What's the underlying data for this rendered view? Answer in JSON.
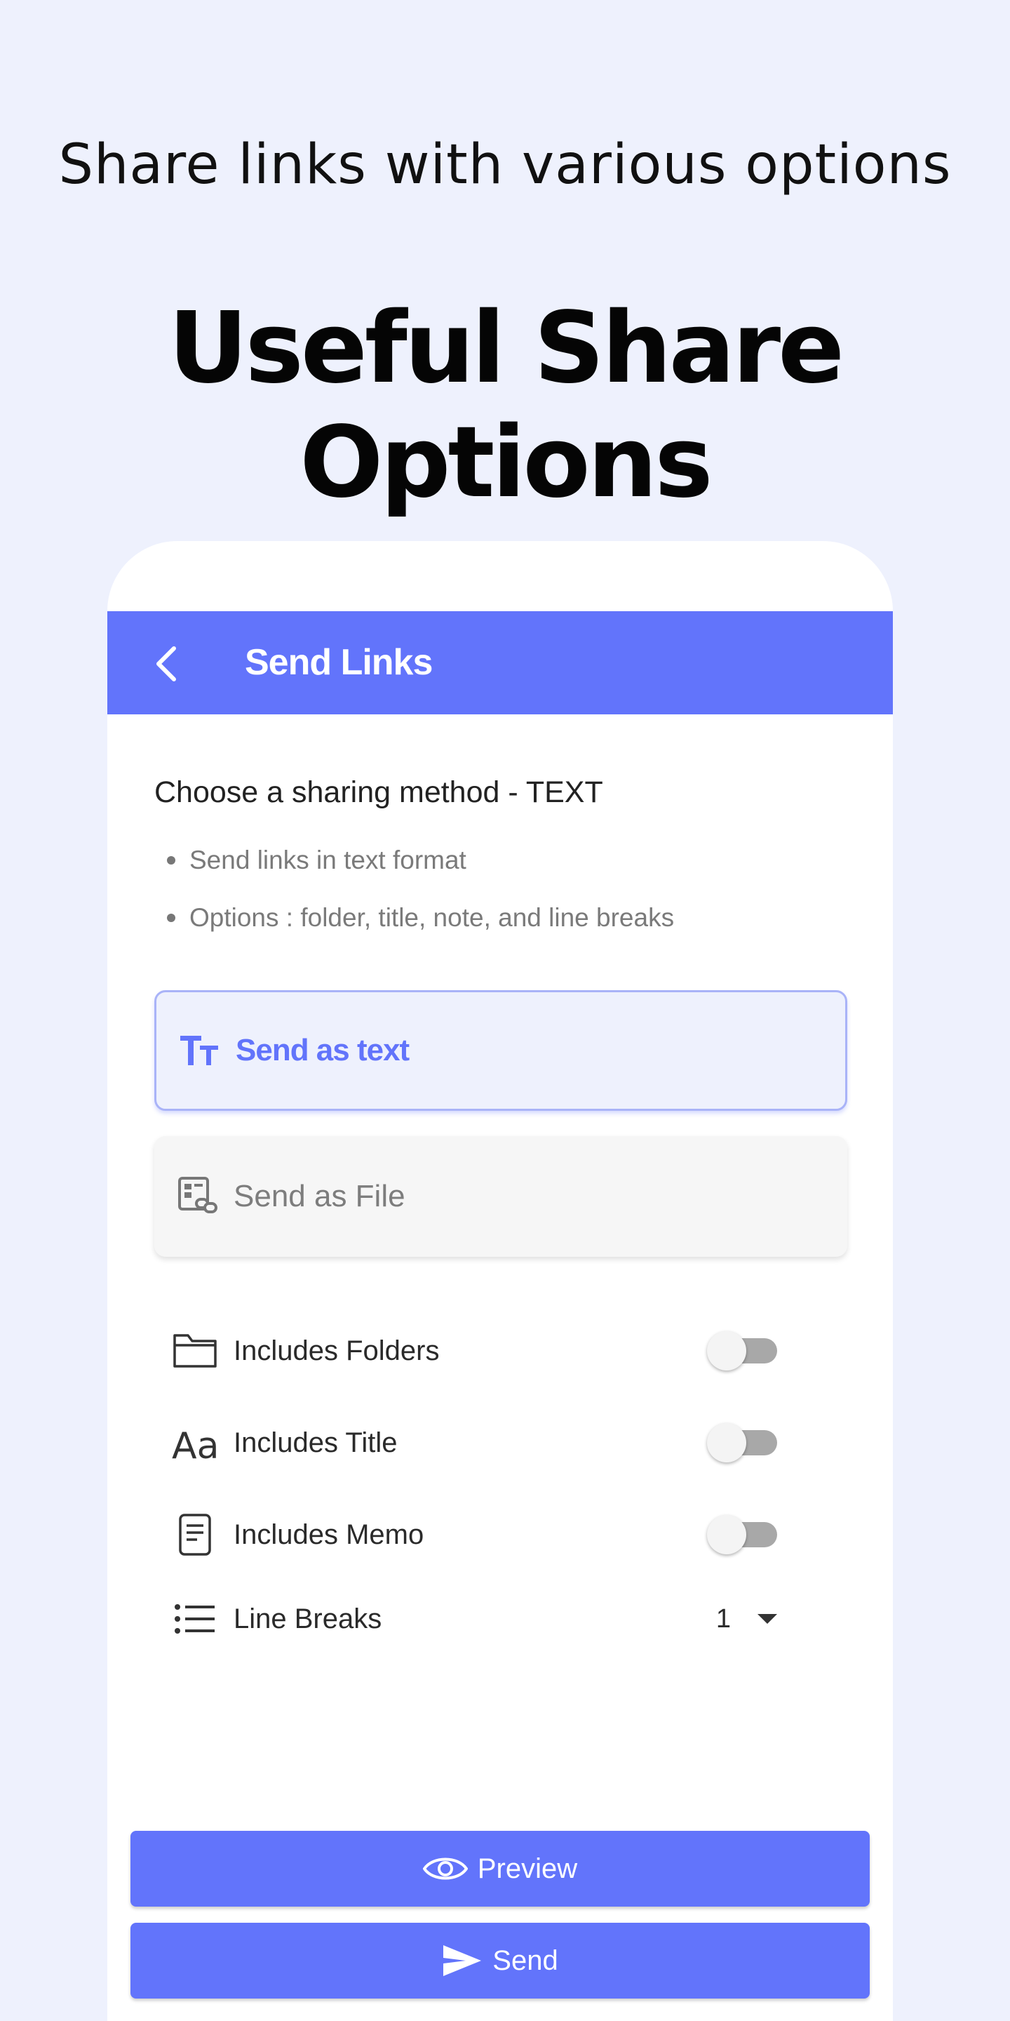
{
  "promo": {
    "subtitle": "Share links with various options",
    "headline": "Useful Share Options"
  },
  "appbar": {
    "title": "Send Links",
    "back_icon": "chevron-left-icon"
  },
  "method": {
    "title": "Choose a sharing method  -  TEXT",
    "bullets": [
      "Send links in text format",
      "Options : folder, title, note, and line breaks"
    ]
  },
  "options": [
    {
      "label": "Send as text",
      "icon": "text-format-icon",
      "selected": true
    },
    {
      "label": "Send as File",
      "icon": "file-link-icon",
      "selected": false
    }
  ],
  "settings": {
    "folders": {
      "label": "Includes Folders",
      "icon": "folder-icon",
      "enabled": false
    },
    "title": {
      "label": "Includes Title",
      "icon": "font-icon",
      "enabled": false
    },
    "memo": {
      "label": "Includes Memo",
      "icon": "memo-icon",
      "enabled": false
    },
    "line_breaks": {
      "label": "Line Breaks",
      "icon": "list-icon",
      "value": "1"
    }
  },
  "buttons": {
    "preview_label": "Preview",
    "preview_icon": "eye-icon",
    "send_label": "Send",
    "send_icon": "send-icon"
  },
  "colors": {
    "accent": "#6274fb",
    "background": "#eef1fd",
    "toggle_off": "#a8a8a8"
  }
}
